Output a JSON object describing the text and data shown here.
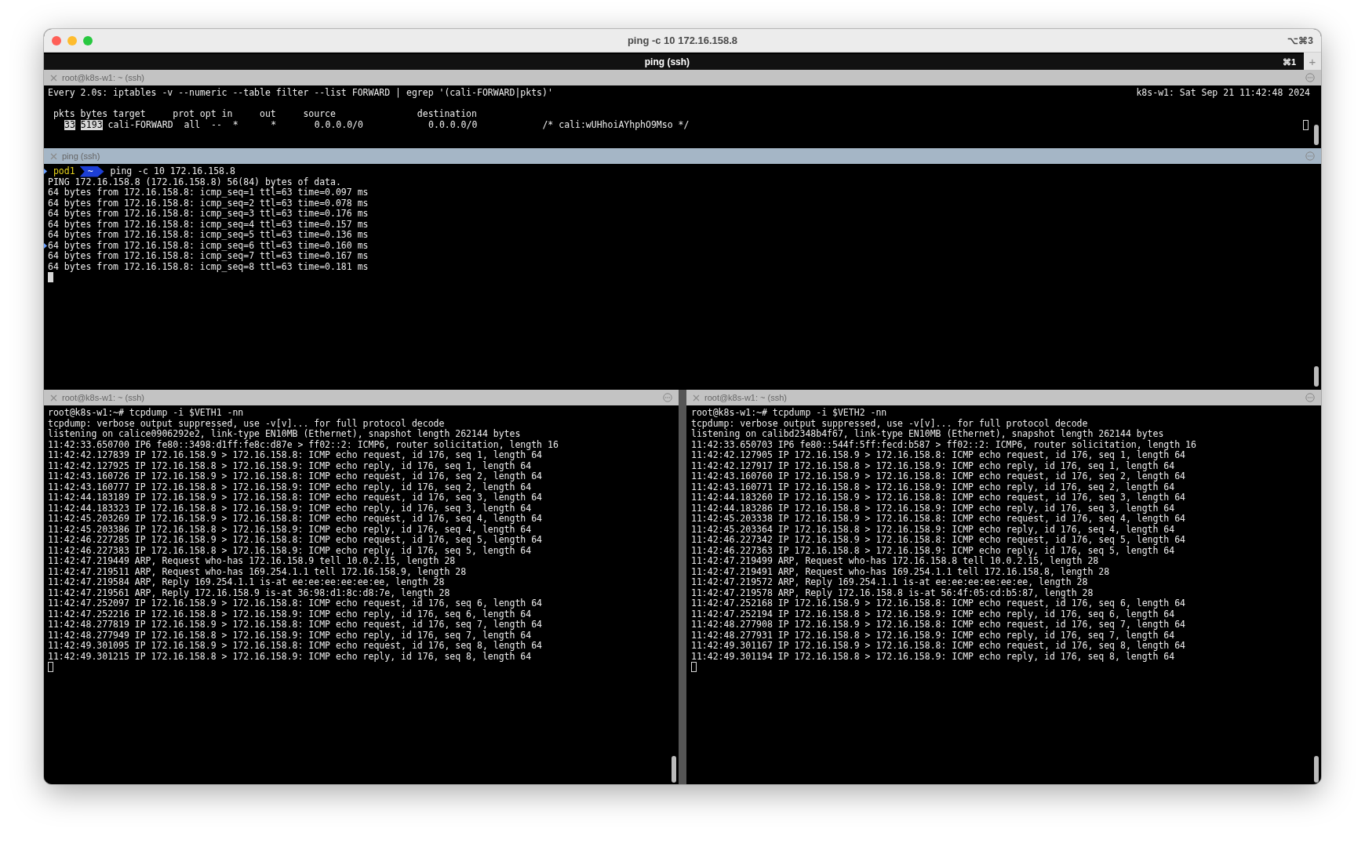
{
  "window": {
    "title": "ping -c 10 172.16.158.8",
    "shortcut": "⌥⌘3"
  },
  "tabs": [
    {
      "label": "ping (ssh)",
      "shortcut": "⌘1",
      "selected": true
    }
  ],
  "new_tab_button": "+",
  "watch_pane": {
    "title": "root@k8s-w1: ~ (ssh)",
    "active": false,
    "command": "Every 2.0s: iptables -v --numeric --table filter --list FORWARD | egrep '(cali-FORWARD|pkts)'",
    "status": "k8s-w1: Sat Sep 21 11:42:48 2024",
    "header": " pkts bytes target     prot opt in     out     source               destination",
    "row": [
      {
        "text": "33",
        "highlighted": true
      },
      {
        "text": "5193",
        "highlighted": true
      },
      {
        "text": "cali-FORWARD  all  --  *      *       0.0.0.0/0            0.0.0.0/0            /* cali:wUHhoiAYhphO9Mso */",
        "highlighted": false
      }
    ]
  },
  "ping_pane": {
    "title": "ping (ssh)",
    "active": true,
    "prompt": {
      "host": "pod1",
      "dir": "~",
      "command": "ping -c 10 172.16.158.8"
    },
    "lines": [
      {
        "text": "PING 172.16.158.8 (172.16.158.8) 56(84) bytes of data.",
        "marked": false
      },
      {
        "text": "64 bytes from 172.16.158.8: icmp_seq=1 ttl=63 time=0.097 ms",
        "marked": false
      },
      {
        "text": "64 bytes from 172.16.158.8: icmp_seq=2 ttl=63 time=0.078 ms",
        "marked": false
      },
      {
        "text": "64 bytes from 172.16.158.8: icmp_seq=3 ttl=63 time=0.176 ms",
        "marked": false
      },
      {
        "text": "64 bytes from 172.16.158.8: icmp_seq=4 ttl=63 time=0.157 ms",
        "marked": false
      },
      {
        "text": "64 bytes from 172.16.158.8: icmp_seq=5 ttl=63 time=0.136 ms",
        "marked": false
      },
      {
        "text": "64 bytes from 172.16.158.8: icmp_seq=6 ttl=63 time=0.160 ms",
        "marked": true
      },
      {
        "text": "64 bytes from 172.16.158.8: icmp_seq=7 ttl=63 time=0.167 ms",
        "marked": false
      },
      {
        "text": "64 bytes from 172.16.158.8: icmp_seq=8 ttl=63 time=0.181 ms",
        "marked": false
      }
    ]
  },
  "tcpdump_panes": [
    {
      "title": "root@k8s-w1: ~ (ssh)",
      "active": false,
      "lines": [
        "root@k8s-w1:~# tcpdump -i $VETH1 -nn",
        "tcpdump: verbose output suppressed, use -v[v]... for full protocol decode",
        "listening on calice0906292e2, link-type EN10MB (Ethernet), snapshot length 262144 bytes",
        "11:42:33.650700 IP6 fe80::3498:d1ff:fe8c:d87e > ff02::2: ICMP6, router solicitation, length 16",
        "11:42:42.127839 IP 172.16.158.9 > 172.16.158.8: ICMP echo request, id 176, seq 1, length 64",
        "11:42:42.127925 IP 172.16.158.8 > 172.16.158.9: ICMP echo reply, id 176, seq 1, length 64",
        "11:42:43.160726 IP 172.16.158.9 > 172.16.158.8: ICMP echo request, id 176, seq 2, length 64",
        "11:42:43.160777 IP 172.16.158.8 > 172.16.158.9: ICMP echo reply, id 176, seq 2, length 64",
        "11:42:44.183189 IP 172.16.158.9 > 172.16.158.8: ICMP echo request, id 176, seq 3, length 64",
        "11:42:44.183323 IP 172.16.158.8 > 172.16.158.9: ICMP echo reply, id 176, seq 3, length 64",
        "11:42:45.203269 IP 172.16.158.9 > 172.16.158.8: ICMP echo request, id 176, seq 4, length 64",
        "11:42:45.203386 IP 172.16.158.8 > 172.16.158.9: ICMP echo reply, id 176, seq 4, length 64",
        "11:42:46.227285 IP 172.16.158.9 > 172.16.158.8: ICMP echo request, id 176, seq 5, length 64",
        "11:42:46.227383 IP 172.16.158.8 > 172.16.158.9: ICMP echo reply, id 176, seq 5, length 64",
        "11:42:47.219449 ARP, Request who-has 172.16.158.9 tell 10.0.2.15, length 28",
        "11:42:47.219511 ARP, Request who-has 169.254.1.1 tell 172.16.158.9, length 28",
        "11:42:47.219584 ARP, Reply 169.254.1.1 is-at ee:ee:ee:ee:ee:ee, length 28",
        "11:42:47.219561 ARP, Reply 172.16.158.9 is-at 36:98:d1:8c:d8:7e, length 28",
        "11:42:47.252097 IP 172.16.158.9 > 172.16.158.8: ICMP echo request, id 176, seq 6, length 64",
        "11:42:47.252216 IP 172.16.158.8 > 172.16.158.9: ICMP echo reply, id 176, seq 6, length 64",
        "11:42:48.277819 IP 172.16.158.9 > 172.16.158.8: ICMP echo request, id 176, seq 7, length 64",
        "11:42:48.277949 IP 172.16.158.8 > 172.16.158.9: ICMP echo reply, id 176, seq 7, length 64",
        "11:42:49.301095 IP 172.16.158.9 > 172.16.158.8: ICMP echo request, id 176, seq 8, length 64",
        "11:42:49.301215 IP 172.16.158.8 > 172.16.158.9: ICMP echo reply, id 176, seq 8, length 64"
      ]
    },
    {
      "title": "root@k8s-w1: ~ (ssh)",
      "active": false,
      "lines": [
        "root@k8s-w1:~# tcpdump -i $VETH2 -nn",
        "tcpdump: verbose output suppressed, use -v[v]... for full protocol decode",
        "listening on calibd2348b4f67, link-type EN10MB (Ethernet), snapshot length 262144 bytes",
        "11:42:33.650703 IP6 fe80::544f:5ff:fecd:b587 > ff02::2: ICMP6, router solicitation, length 16",
        "11:42:42.127905 IP 172.16.158.9 > 172.16.158.8: ICMP echo request, id 176, seq 1, length 64",
        "11:42:42.127917 IP 172.16.158.8 > 172.16.158.9: ICMP echo reply, id 176, seq 1, length 64",
        "11:42:43.160760 IP 172.16.158.9 > 172.16.158.8: ICMP echo request, id 176, seq 2, length 64",
        "11:42:43.160771 IP 172.16.158.8 > 172.16.158.9: ICMP echo reply, id 176, seq 2, length 64",
        "11:42:44.183260 IP 172.16.158.9 > 172.16.158.8: ICMP echo request, id 176, seq 3, length 64",
        "11:42:44.183286 IP 172.16.158.8 > 172.16.158.9: ICMP echo reply, id 176, seq 3, length 64",
        "11:42:45.203338 IP 172.16.158.9 > 172.16.158.8: ICMP echo request, id 176, seq 4, length 64",
        "11:42:45.203364 IP 172.16.158.8 > 172.16.158.9: ICMP echo reply, id 176, seq 4, length 64",
        "11:42:46.227342 IP 172.16.158.9 > 172.16.158.8: ICMP echo request, id 176, seq 5, length 64",
        "11:42:46.227363 IP 172.16.158.8 > 172.16.158.9: ICMP echo reply, id 176, seq 5, length 64",
        "11:42:47.219499 ARP, Request who-has 172.16.158.8 tell 10.0.2.15, length 28",
        "11:42:47.219491 ARP, Request who-has 169.254.1.1 tell 172.16.158.8, length 28",
        "11:42:47.219572 ARP, Reply 169.254.1.1 is-at ee:ee:ee:ee:ee:ee, length 28",
        "11:42:47.219578 ARP, Reply 172.16.158.8 is-at 56:4f:05:cd:b5:87, length 28",
        "11:42:47.252168 IP 172.16.158.9 > 172.16.158.8: ICMP echo request, id 176, seq 6, length 64",
        "11:42:47.252194 IP 172.16.158.8 > 172.16.158.9: ICMP echo reply, id 176, seq 6, length 64",
        "11:42:48.277908 IP 172.16.158.9 > 172.16.158.8: ICMP echo request, id 176, seq 7, length 64",
        "11:42:48.277931 IP 172.16.158.8 > 172.16.158.9: ICMP echo reply, id 176, seq 7, length 64",
        "11:42:49.301167 IP 172.16.158.9 > 172.16.158.8: ICMP echo request, id 176, seq 8, length 64",
        "11:42:49.301194 IP 172.16.158.8 > 172.16.158.9: ICMP echo reply, id 176, seq 8, length 64"
      ]
    }
  ]
}
